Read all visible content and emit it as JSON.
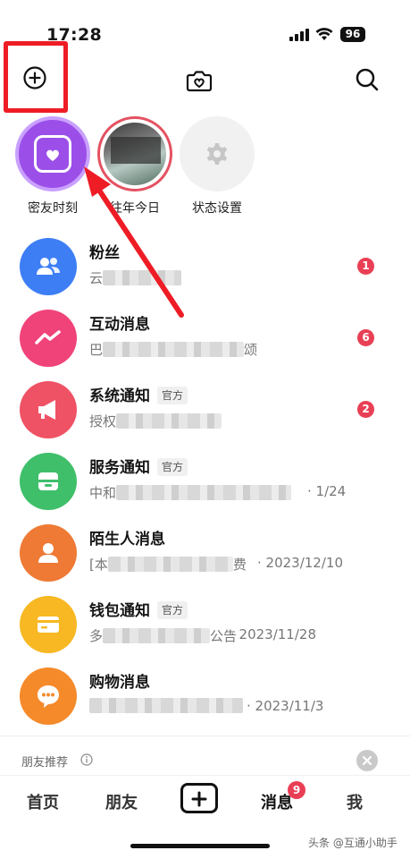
{
  "status_bar": {
    "time": "17:28",
    "battery": "96"
  },
  "stories": [
    {
      "label": "密友时刻"
    },
    {
      "label": "往年今日"
    },
    {
      "label": "状态设置"
    }
  ],
  "messages": [
    {
      "title": "粉丝",
      "preview_prefix": "云",
      "preview_suffix": "",
      "date": "",
      "unread": "1",
      "official": "",
      "color": "#3d7ef5"
    },
    {
      "title": "互动消息",
      "preview_prefix": "巴",
      "preview_suffix": "颂",
      "date": "",
      "unread": "6",
      "official": "",
      "color": "#f0437a"
    },
    {
      "title": "系统通知",
      "preview_prefix": "授权",
      "preview_suffix": "",
      "date": "",
      "unread": "2",
      "official": "官方",
      "color": "#ef5265"
    },
    {
      "title": "服务通知",
      "preview_prefix": "中和",
      "preview_suffix": "",
      "date": "· 1/24",
      "unread": "",
      "official": "官方",
      "color": "#3fbf6a"
    },
    {
      "title": "陌生人消息",
      "preview_prefix": "[本",
      "preview_suffix": "费",
      "date": "· 2023/12/10",
      "unread": "",
      "official": "",
      "color": "#ee7a35"
    },
    {
      "title": "钱包通知",
      "preview_prefix": "多",
      "preview_suffix": "公告",
      "date": "· 2023/11/28",
      "unread": "",
      "official": "官方",
      "color": "#f7b823"
    },
    {
      "title": "购物消息",
      "preview_prefix": "",
      "preview_suffix": "",
      "date": "· 2023/11/3",
      "unread": "",
      "official": "",
      "color": "#f58a2b"
    }
  ],
  "friend_recommend": {
    "label": "朋友推荐"
  },
  "nav": {
    "home": "首页",
    "friends": "朋友",
    "messages": "消息",
    "messages_badge": "9",
    "me": "我"
  },
  "watermark": "头条 @互通小助手",
  "colors": {
    "highlight": "#ee1c25",
    "badge": "#e93f55"
  }
}
